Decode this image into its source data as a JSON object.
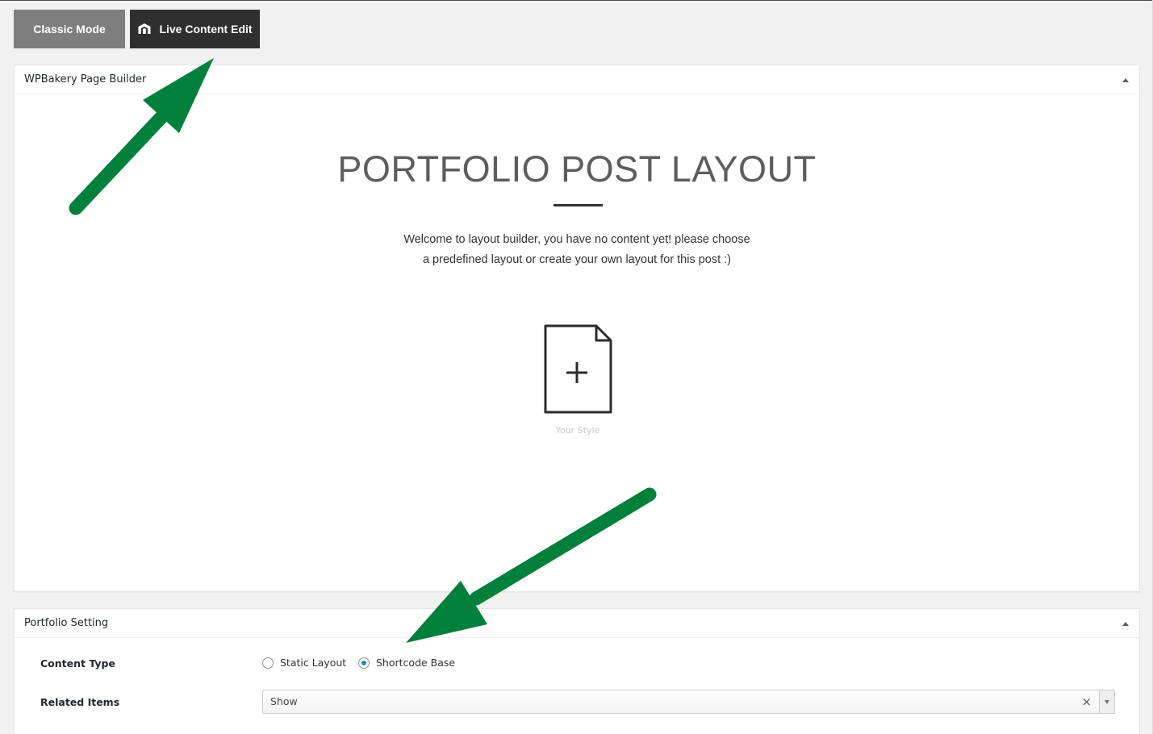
{
  "toolbar": {
    "classic_mode_label": "Classic Mode",
    "live_edit_label": "Live Content Edit",
    "live_edit_icon": "brand-logo-icon"
  },
  "builder_box": {
    "title": "WPBakery Page Builder",
    "toggle_icon": "collapse-arrow-icon",
    "heading": "PORTFOLIO POST LAYOUT",
    "welcome_line1": "Welcome to layout builder, you have no content yet! please choose",
    "welcome_line2": "a predefined layout or create your own layout for this post :)",
    "style_option": {
      "icon": "new-document-plus-icon",
      "caption": "Your Style"
    }
  },
  "setting_box": {
    "title": "Portfolio Setting",
    "toggle_icon": "collapse-arrow-icon",
    "content_type": {
      "label": "Content Type",
      "options": [
        {
          "label": "Static Layout",
          "checked": false
        },
        {
          "label": "Shortcode Base",
          "checked": true
        }
      ]
    },
    "related_items": {
      "label": "Related Items",
      "value": "Show",
      "clear_symbol": "×"
    }
  },
  "annotations": {
    "arrow_color": "#00803b"
  },
  "colors": {
    "classic_button_bg": "#7e7e7e",
    "live_button_bg": "#2f2f2f",
    "radio_checked": "#1e8cbe",
    "page_bg": "#f1f1f1"
  }
}
